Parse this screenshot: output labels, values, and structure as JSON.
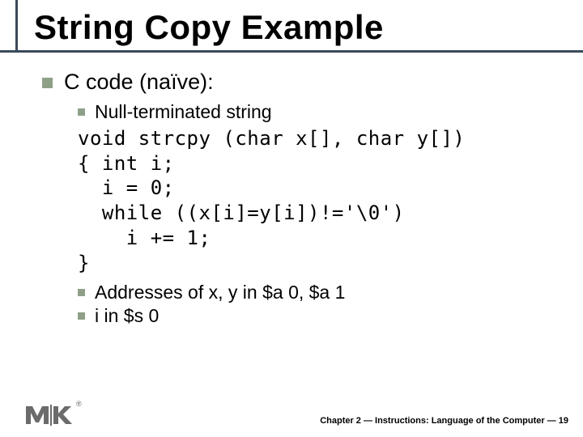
{
  "title": "String Copy Example",
  "section": {
    "heading": "C code (naïve):",
    "sub1": "Null-terminated string",
    "code": "void strcpy (char x[], char y[])\n{ int i;\n  i = 0;\n  while ((x[i]=y[i])!='\\0')\n    i += 1;\n}",
    "sub2": "Addresses of x, y in $a 0, $a 1",
    "sub3": "i in $s 0"
  },
  "footer": "Chapter 2 — Instructions: Language of the Computer — 19"
}
